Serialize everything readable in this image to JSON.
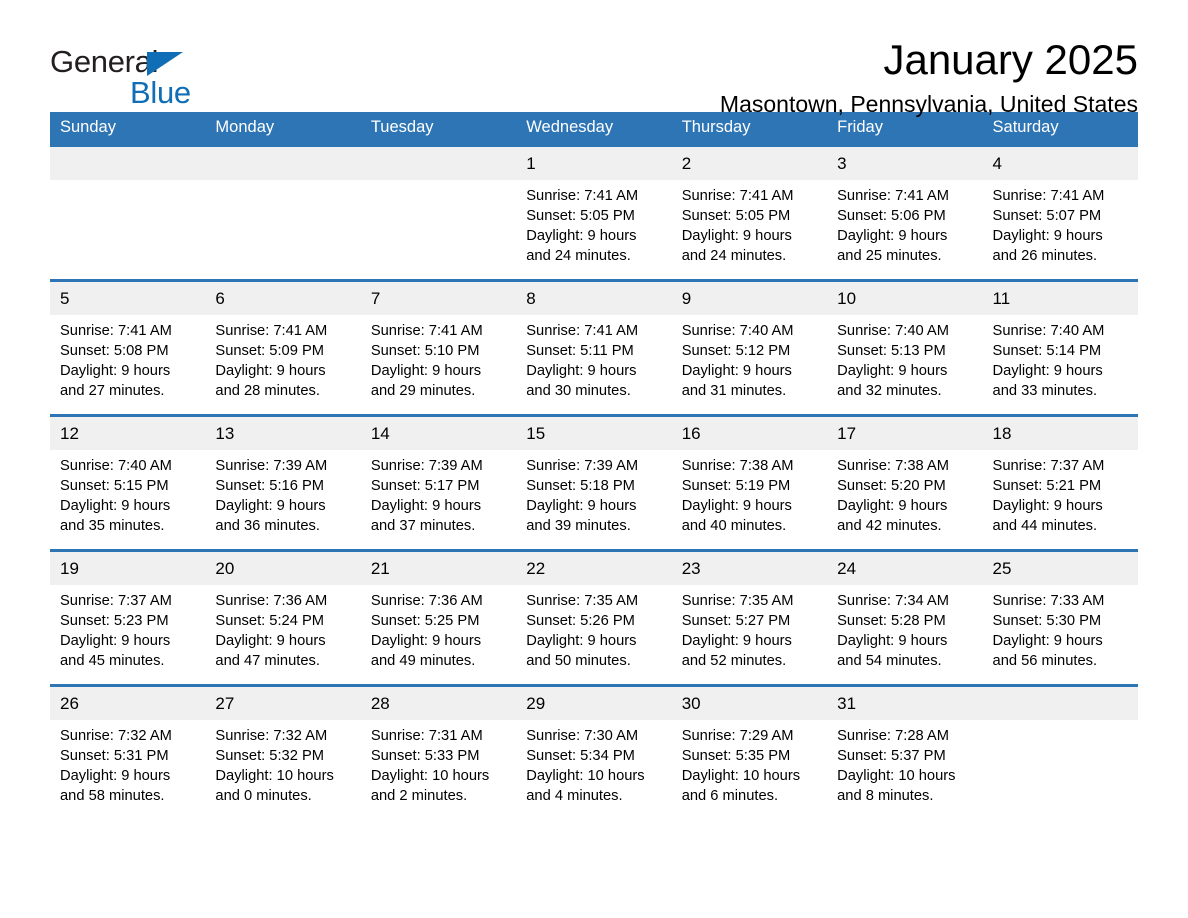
{
  "logo": {
    "word_one": "General",
    "word_two": "Blue",
    "triangle_color": "#0f6eb5"
  },
  "header": {
    "title": "January 2025",
    "subtitle": "Masontown, Pennsylvania, United States"
  },
  "theme": {
    "header_blue": "#2e75b6",
    "daynum_band": "#f0f0f0",
    "text": "#000000"
  },
  "calendar": {
    "weekday_headers": [
      "Sunday",
      "Monday",
      "Tuesday",
      "Wednesday",
      "Thursday",
      "Friday",
      "Saturday"
    ],
    "weeks": [
      [
        {
          "day": "",
          "lines": []
        },
        {
          "day": "",
          "lines": []
        },
        {
          "day": "",
          "lines": []
        },
        {
          "day": "1",
          "lines": [
            "Sunrise: 7:41 AM",
            "Sunset: 5:05 PM",
            "Daylight: 9 hours and 24 minutes."
          ]
        },
        {
          "day": "2",
          "lines": [
            "Sunrise: 7:41 AM",
            "Sunset: 5:05 PM",
            "Daylight: 9 hours and 24 minutes."
          ]
        },
        {
          "day": "3",
          "lines": [
            "Sunrise: 7:41 AM",
            "Sunset: 5:06 PM",
            "Daylight: 9 hours and 25 minutes."
          ]
        },
        {
          "day": "4",
          "lines": [
            "Sunrise: 7:41 AM",
            "Sunset: 5:07 PM",
            "Daylight: 9 hours and 26 minutes."
          ]
        }
      ],
      [
        {
          "day": "5",
          "lines": [
            "Sunrise: 7:41 AM",
            "Sunset: 5:08 PM",
            "Daylight: 9 hours and 27 minutes."
          ]
        },
        {
          "day": "6",
          "lines": [
            "Sunrise: 7:41 AM",
            "Sunset: 5:09 PM",
            "Daylight: 9 hours and 28 minutes."
          ]
        },
        {
          "day": "7",
          "lines": [
            "Sunrise: 7:41 AM",
            "Sunset: 5:10 PM",
            "Daylight: 9 hours and 29 minutes."
          ]
        },
        {
          "day": "8",
          "lines": [
            "Sunrise: 7:41 AM",
            "Sunset: 5:11 PM",
            "Daylight: 9 hours and 30 minutes."
          ]
        },
        {
          "day": "9",
          "lines": [
            "Sunrise: 7:40 AM",
            "Sunset: 5:12 PM",
            "Daylight: 9 hours and 31 minutes."
          ]
        },
        {
          "day": "10",
          "lines": [
            "Sunrise: 7:40 AM",
            "Sunset: 5:13 PM",
            "Daylight: 9 hours and 32 minutes."
          ]
        },
        {
          "day": "11",
          "lines": [
            "Sunrise: 7:40 AM",
            "Sunset: 5:14 PM",
            "Daylight: 9 hours and 33 minutes."
          ]
        }
      ],
      [
        {
          "day": "12",
          "lines": [
            "Sunrise: 7:40 AM",
            "Sunset: 5:15 PM",
            "Daylight: 9 hours and 35 minutes."
          ]
        },
        {
          "day": "13",
          "lines": [
            "Sunrise: 7:39 AM",
            "Sunset: 5:16 PM",
            "Daylight: 9 hours and 36 minutes."
          ]
        },
        {
          "day": "14",
          "lines": [
            "Sunrise: 7:39 AM",
            "Sunset: 5:17 PM",
            "Daylight: 9 hours and 37 minutes."
          ]
        },
        {
          "day": "15",
          "lines": [
            "Sunrise: 7:39 AM",
            "Sunset: 5:18 PM",
            "Daylight: 9 hours and 39 minutes."
          ]
        },
        {
          "day": "16",
          "lines": [
            "Sunrise: 7:38 AM",
            "Sunset: 5:19 PM",
            "Daylight: 9 hours and 40 minutes."
          ]
        },
        {
          "day": "17",
          "lines": [
            "Sunrise: 7:38 AM",
            "Sunset: 5:20 PM",
            "Daylight: 9 hours and 42 minutes."
          ]
        },
        {
          "day": "18",
          "lines": [
            "Sunrise: 7:37 AM",
            "Sunset: 5:21 PM",
            "Daylight: 9 hours and 44 minutes."
          ]
        }
      ],
      [
        {
          "day": "19",
          "lines": [
            "Sunrise: 7:37 AM",
            "Sunset: 5:23 PM",
            "Daylight: 9 hours and 45 minutes."
          ]
        },
        {
          "day": "20",
          "lines": [
            "Sunrise: 7:36 AM",
            "Sunset: 5:24 PM",
            "Daylight: 9 hours and 47 minutes."
          ]
        },
        {
          "day": "21",
          "lines": [
            "Sunrise: 7:36 AM",
            "Sunset: 5:25 PM",
            "Daylight: 9 hours and 49 minutes."
          ]
        },
        {
          "day": "22",
          "lines": [
            "Sunrise: 7:35 AM",
            "Sunset: 5:26 PM",
            "Daylight: 9 hours and 50 minutes."
          ]
        },
        {
          "day": "23",
          "lines": [
            "Sunrise: 7:35 AM",
            "Sunset: 5:27 PM",
            "Daylight: 9 hours and 52 minutes."
          ]
        },
        {
          "day": "24",
          "lines": [
            "Sunrise: 7:34 AM",
            "Sunset: 5:28 PM",
            "Daylight: 9 hours and 54 minutes."
          ]
        },
        {
          "day": "25",
          "lines": [
            "Sunrise: 7:33 AM",
            "Sunset: 5:30 PM",
            "Daylight: 9 hours and 56 minutes."
          ]
        }
      ],
      [
        {
          "day": "26",
          "lines": [
            "Sunrise: 7:32 AM",
            "Sunset: 5:31 PM",
            "Daylight: 9 hours and 58 minutes."
          ]
        },
        {
          "day": "27",
          "lines": [
            "Sunrise: 7:32 AM",
            "Sunset: 5:32 PM",
            "Daylight: 10 hours and 0 minutes."
          ]
        },
        {
          "day": "28",
          "lines": [
            "Sunrise: 7:31 AM",
            "Sunset: 5:33 PM",
            "Daylight: 10 hours and 2 minutes."
          ]
        },
        {
          "day": "29",
          "lines": [
            "Sunrise: 7:30 AM",
            "Sunset: 5:34 PM",
            "Daylight: 10 hours and 4 minutes."
          ]
        },
        {
          "day": "30",
          "lines": [
            "Sunrise: 7:29 AM",
            "Sunset: 5:35 PM",
            "Daylight: 10 hours and 6 minutes."
          ]
        },
        {
          "day": "31",
          "lines": [
            "Sunrise: 7:28 AM",
            "Sunset: 5:37 PM",
            "Daylight: 10 hours and 8 minutes."
          ]
        },
        {
          "day": "",
          "lines": []
        }
      ]
    ]
  }
}
